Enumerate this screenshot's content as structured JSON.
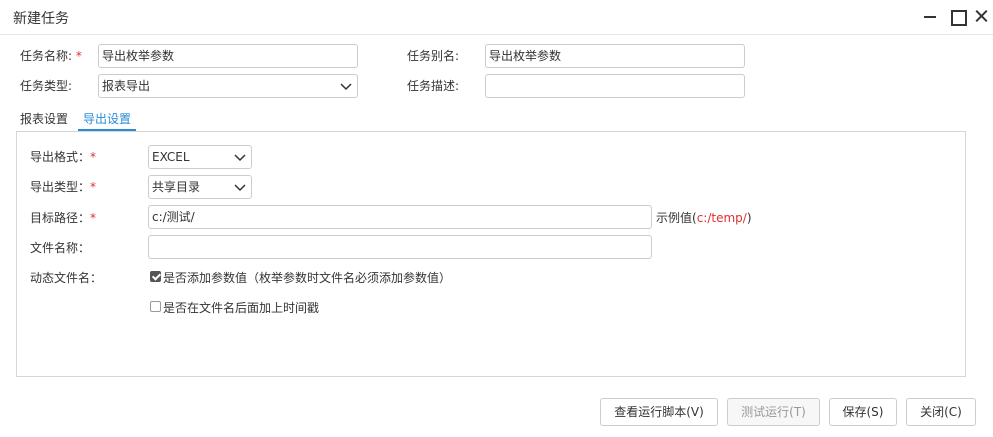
{
  "window": {
    "title": "新建任务"
  },
  "form": {
    "task_name": {
      "label": "任务名称:",
      "required_mark": "*",
      "value": "导出枚举参数"
    },
    "task_alias": {
      "label": "任务别名:",
      "value": "导出枚举参数"
    },
    "task_type": {
      "label": "任务类型:",
      "value": "报表导出"
    },
    "task_desc": {
      "label": "任务描述:",
      "value": ""
    }
  },
  "tabs": [
    {
      "label": "报表设置",
      "active": false
    },
    {
      "label": "导出设置",
      "active": true
    }
  ],
  "export": {
    "format": {
      "label": "导出格式：",
      "required_mark": "*",
      "value": "EXCEL"
    },
    "type": {
      "label": "导出类型：",
      "required_mark": "*",
      "value": "共享目录"
    },
    "target_path": {
      "label": "目标路径：",
      "required_mark": "*",
      "value": "c:/测试/",
      "example_prefix": "示例值(",
      "example_value": "c:/temp/",
      "example_suffix": ")"
    },
    "file_name": {
      "label": "文件名称：",
      "value": ""
    },
    "dynamic_name": {
      "label": "动态文件名：",
      "add_param": {
        "checked": true,
        "label": "是否添加参数值（枚举参数时文件名必须添加参数值）"
      },
      "add_timestamp": {
        "checked": false,
        "label": "是否在文件名后面加上时间戳"
      }
    }
  },
  "buttons": {
    "view_script": "查看运行脚本(V)",
    "test_run": "测试运行(T)",
    "save": "保存(S)",
    "close": "关闭(C)"
  },
  "colors": {
    "accent": "#2a8cd6",
    "required": "#e03030"
  }
}
